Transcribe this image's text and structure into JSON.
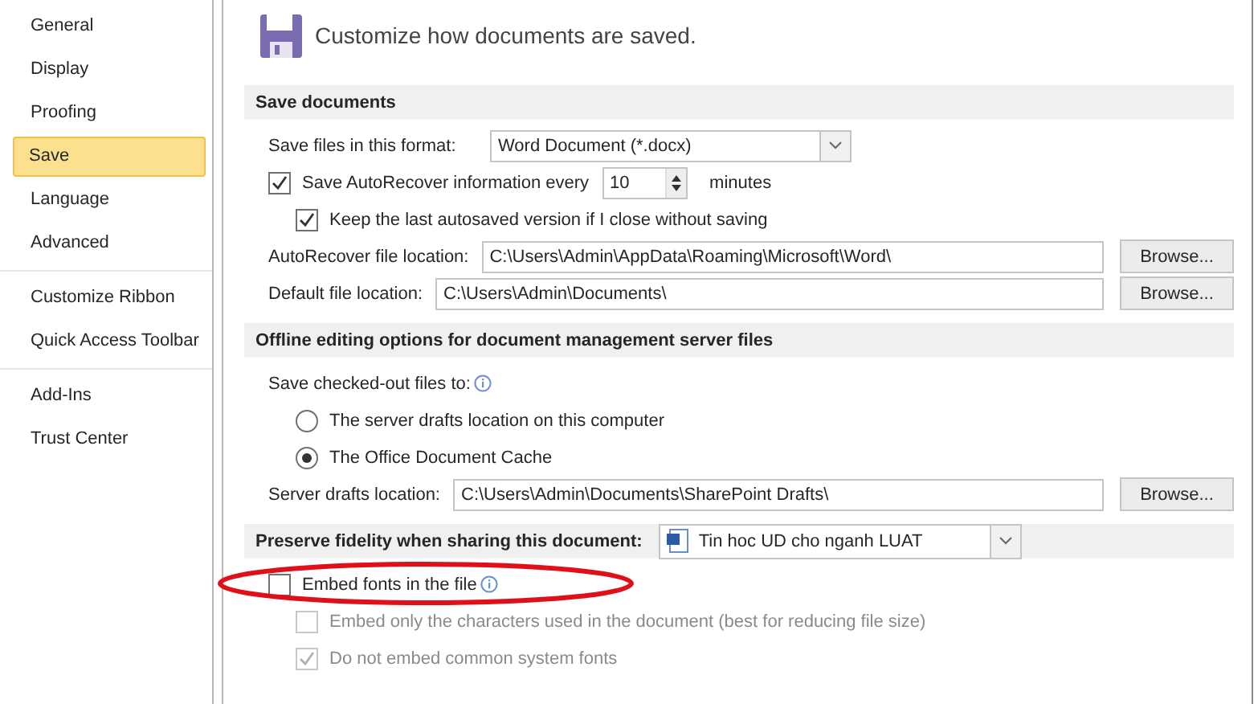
{
  "sidebar": {
    "groups": [
      [
        {
          "label": "General",
          "selected": false
        },
        {
          "label": "Display",
          "selected": false
        },
        {
          "label": "Proofing",
          "selected": false
        },
        {
          "label": "Save",
          "selected": true
        },
        {
          "label": "Language",
          "selected": false
        },
        {
          "label": "Advanced",
          "selected": false
        }
      ],
      [
        {
          "label": "Customize Ribbon",
          "selected": false
        },
        {
          "label": "Quick Access Toolbar",
          "selected": false
        }
      ],
      [
        {
          "label": "Add-Ins",
          "selected": false
        },
        {
          "label": "Trust Center",
          "selected": false
        }
      ]
    ]
  },
  "header": {
    "title": "Customize how documents are saved."
  },
  "sections": [
    {
      "title": "Save documents",
      "rows": [
        {
          "kind": "select",
          "label": "Save files in this format:",
          "value": "Word Document (*.docx)"
        },
        {
          "kind": "check-spin",
          "label": "Save AutoRecover information every",
          "checked": true,
          "value": "10",
          "unit": "minutes",
          "children": [
            {
              "kind": "check",
              "label": "Keep the last autosaved version if I close without saving",
              "checked": true
            }
          ]
        },
        {
          "kind": "path",
          "label": "AutoRecover file location:",
          "value": "C:\\Users\\Admin\\AppData\\Roaming\\Microsoft\\Word\\",
          "button": "Browse..."
        },
        {
          "kind": "path",
          "label": "Default file location:",
          "value": "C:\\Users\\Admin\\Documents\\",
          "button": "Browse..."
        }
      ]
    },
    {
      "title": "Offline editing options for document management server files",
      "rows": [
        {
          "kind": "label",
          "label": "Save checked-out files to:",
          "info": true,
          "children": [
            {
              "kind": "radio",
              "label": "The server drafts location on this computer",
              "selected": false
            },
            {
              "kind": "radio",
              "label": "The Office Document Cache",
              "selected": true
            }
          ]
        },
        {
          "kind": "path",
          "label": "Server drafts location:",
          "value": "C:\\Users\\Admin\\Documents\\SharePoint Drafts\\",
          "button": "Browse..."
        }
      ]
    },
    {
      "title": "Preserve fidelity when sharing this document:",
      "document": "Tin hoc UD cho nganh LUAT",
      "rows": [
        {
          "kind": "check",
          "label": "Embed fonts in the file",
          "checked": false,
          "info": true,
          "children": [
            {
              "kind": "check",
              "label": "Embed only the characters used in the document (best for reducing file size)",
              "checked": false,
              "disabled": true
            },
            {
              "kind": "check",
              "label": "Do not embed common system fonts",
              "checked": true,
              "disabled": true
            }
          ]
        }
      ]
    }
  ]
}
